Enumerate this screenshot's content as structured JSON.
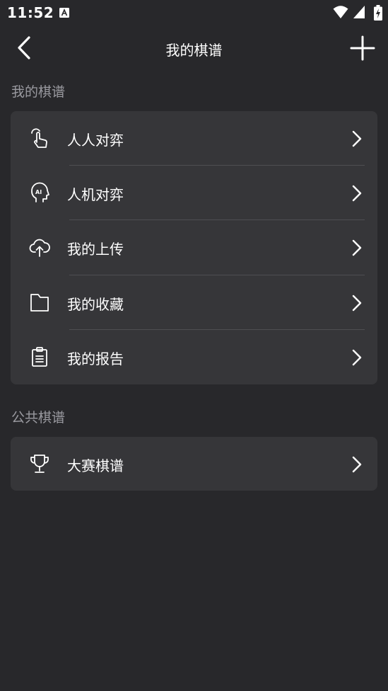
{
  "status_bar": {
    "time": "11:52",
    "icons": [
      "a-notification-icon",
      "wifi-icon",
      "signal-icon",
      "battery-charging-icon"
    ]
  },
  "app_bar": {
    "title": "我的棋谱",
    "back_icon": "chevron-left-icon",
    "add_icon": "plus-icon"
  },
  "sections": {
    "my_records": {
      "title": "我的棋谱",
      "items": [
        {
          "label": "人人对弈",
          "icon": "hand-touch-icon"
        },
        {
          "label": "人机对弈",
          "icon": "ai-head-icon"
        },
        {
          "label": "我的上传",
          "icon": "cloud-upload-icon"
        },
        {
          "label": "我的收藏",
          "icon": "folder-icon"
        },
        {
          "label": "我的报告",
          "icon": "clipboard-icon"
        }
      ]
    },
    "public_records": {
      "title": "公共棋谱",
      "items": [
        {
          "label": "大赛棋谱",
          "icon": "trophy-icon"
        }
      ]
    }
  },
  "colors": {
    "background": "#28282b",
    "card": "#363639",
    "section_title": "#9a9aa0",
    "text": "#ffffff"
  }
}
